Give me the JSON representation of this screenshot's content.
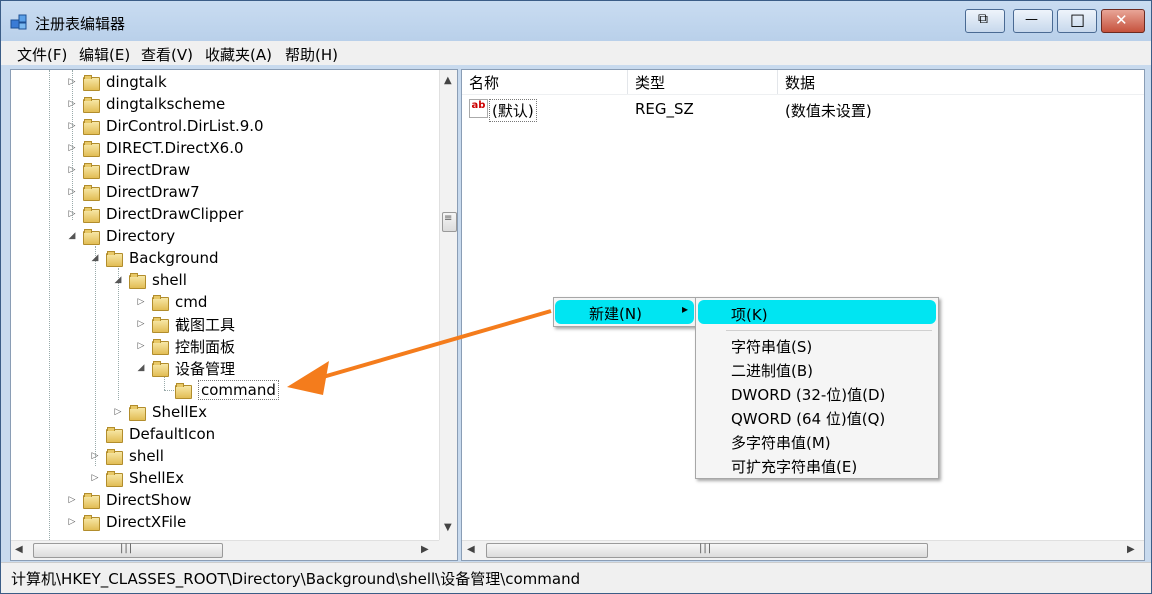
{
  "window": {
    "title": "注册表编辑器"
  },
  "window_buttons": {
    "restore": "⧉",
    "minimize": "—",
    "maximize": "□",
    "close": "✕"
  },
  "menu": [
    "文件(F)",
    "编辑(E)",
    "查看(V)",
    "收藏夹(A)",
    "帮助(H)"
  ],
  "tree": [
    {
      "label": "dingtalk",
      "expander": "▷"
    },
    {
      "label": "dingtalkscheme",
      "expander": "▷"
    },
    {
      "label": "DirControl.DirList.9.0",
      "expander": "▷"
    },
    {
      "label": "DIRECT.DirectX6.0",
      "expander": "▷"
    },
    {
      "label": "DirectDraw",
      "expander": "▷"
    },
    {
      "label": "DirectDraw7",
      "expander": "▷"
    },
    {
      "label": "DirectDrawClipper",
      "expander": "▷"
    },
    {
      "label": "Directory",
      "expander": "◢"
    },
    {
      "label": "Background",
      "expander": "◢"
    },
    {
      "label": "shell",
      "expander": "◢"
    },
    {
      "label": "cmd",
      "expander": "▷"
    },
    {
      "label": "截图工具",
      "expander": "▷"
    },
    {
      "label": "控制面板",
      "expander": "▷"
    },
    {
      "label": "设备管理",
      "expander": "◢"
    },
    {
      "label": "command",
      "expander": ""
    },
    {
      "label": "ShellEx",
      "expander": "▷"
    },
    {
      "label": "DefaultIcon",
      "expander": ""
    },
    {
      "label": "shell",
      "expander": "▷"
    },
    {
      "label": "ShellEx",
      "expander": "▷"
    },
    {
      "label": "DirectShow",
      "expander": "▷"
    },
    {
      "label": "DirectXFile",
      "expander": "▷"
    }
  ],
  "scroll": {
    "grip": "|||",
    "up": "▲",
    "down": "▼",
    "left": "◀",
    "right": "▶",
    "vgrip": "≡"
  },
  "list": {
    "headers": [
      "名称",
      "类型",
      "数据"
    ],
    "rows": [
      {
        "name": "(默认)",
        "type": "REG_SZ",
        "data": "(数值未设置)",
        "icon": "ab"
      }
    ]
  },
  "context_menu": {
    "new_label": "新建(N)",
    "arrow": "▸",
    "submenu": [
      "项(K)",
      "字符串值(S)",
      "二进制值(B)",
      "DWORD (32-位)值(D)",
      "QWORD (64 位)值(Q)",
      "多字符串值(M)",
      "可扩充字符串值(E)"
    ]
  },
  "status_path": "计算机\\HKEY_CLASSES_ROOT\\Directory\\Background\\shell\\设备管理\\command",
  "colors": {
    "highlight": "#00e5f2",
    "arrow": "#f47c1c",
    "titlebar": "#c9dcf1"
  }
}
